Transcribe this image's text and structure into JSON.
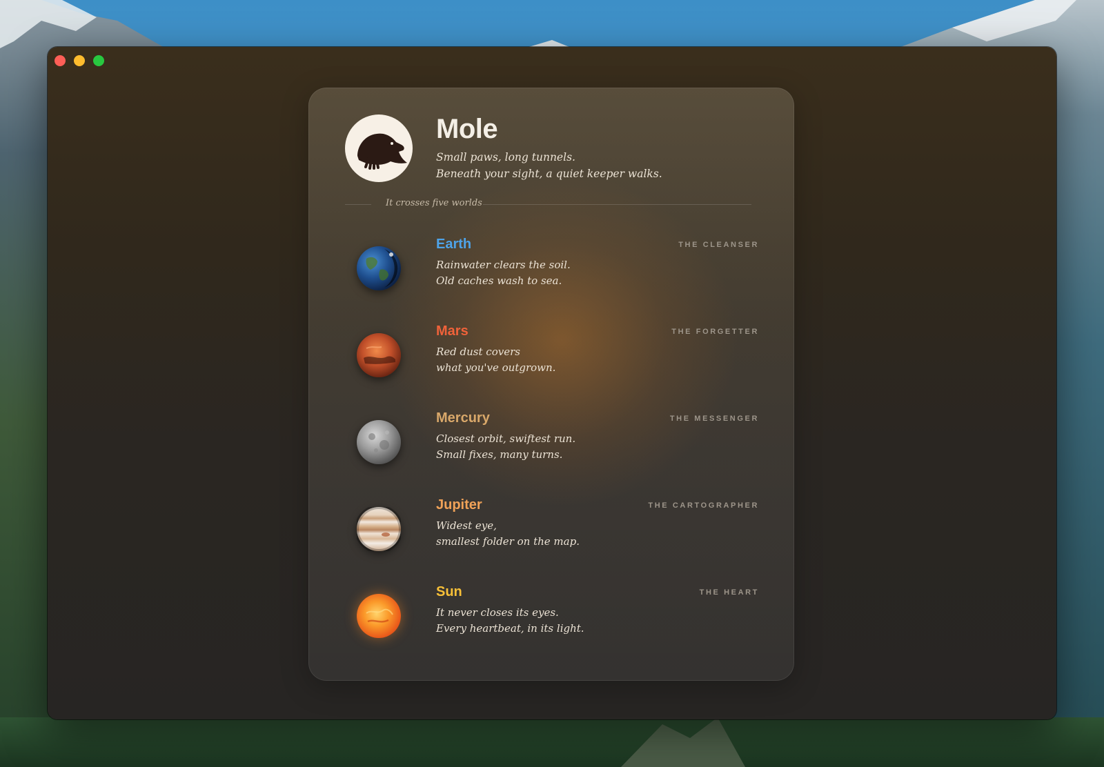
{
  "app": {
    "title": "Mole",
    "tagline": [
      "Small paws, long tunnels.",
      "Beneath your sight, a quiet keeper walks."
    ],
    "section_label": "It crosses five worlds"
  },
  "worlds": [
    {
      "name": "Earth",
      "role": "THE CLEANSER",
      "lines": [
        "Rainwater clears the soil.",
        "Old caches wash to sea."
      ],
      "color": "#4ea3e8",
      "icon": "earth-icon"
    },
    {
      "name": "Mars",
      "role": "THE FORGETTER",
      "lines": [
        "Red dust covers",
        "what you've outgrown."
      ],
      "color": "#f0623a",
      "icon": "mars-icon"
    },
    {
      "name": "Mercury",
      "role": "THE MESSENGER",
      "lines": [
        "Closest orbit, swiftest run.",
        "Small fixes, many turns."
      ],
      "color": "#d9a86a",
      "icon": "mercury-icon"
    },
    {
      "name": "Jupiter",
      "role": "THE CARTOGRAPHER",
      "lines": [
        "Widest eye,",
        "smallest folder on the map."
      ],
      "color": "#f0a258",
      "icon": "jupiter-icon"
    },
    {
      "name": "Sun",
      "role": "THE HEART",
      "lines": [
        "It never closes its eyes.",
        "Every heartbeat, in its light."
      ],
      "color": "#f8c038",
      "icon": "sun-icon"
    }
  ],
  "window_controls": {
    "close_color": "#fe5f57",
    "minimize_color": "#febc2e",
    "maximize_color": "#28c840"
  }
}
